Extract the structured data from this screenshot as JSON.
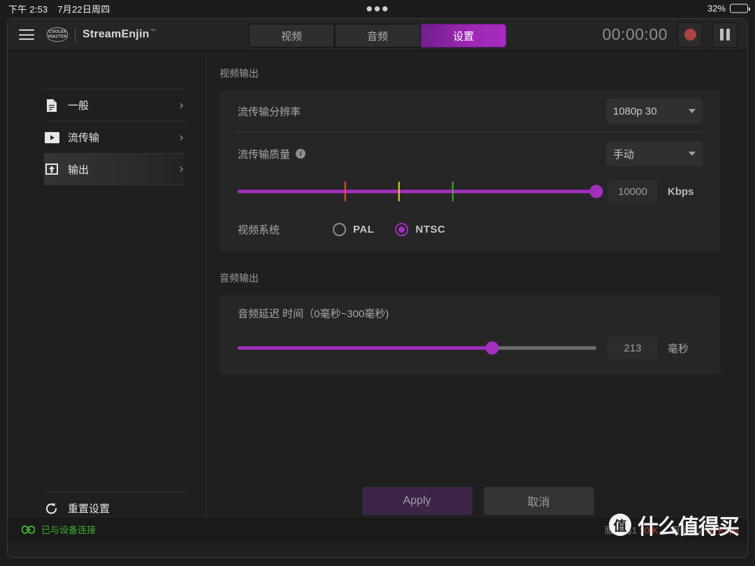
{
  "os_bar": {
    "time": "下午 2:53",
    "date": "7月22日周四",
    "menu_dots": "●●●",
    "battery_percent": "32%",
    "battery_level": 32
  },
  "header": {
    "menu_icon": "hamburger-icon",
    "logo_line1": "COOLER",
    "logo_line2": "MASTER",
    "app_name": "StreamEnjin",
    "trademark": "™",
    "tabs": [
      {
        "label": "视频",
        "active": false
      },
      {
        "label": "音频",
        "active": false
      },
      {
        "label": "设置",
        "active": true
      }
    ],
    "timer": "00:00:00",
    "record_icon": "record-icon",
    "pause_icon": "pause-icon"
  },
  "sidebar": {
    "items": [
      {
        "label": "一般",
        "icon": "document-icon",
        "active": false
      },
      {
        "label": "流传输",
        "icon": "play-video-icon",
        "active": false
      },
      {
        "label": "输出",
        "icon": "upload-icon",
        "active": true
      }
    ],
    "chevron": "›",
    "reset": {
      "label": "重置设置",
      "icon": "reset-arrow-icon"
    }
  },
  "video_section": {
    "title": "视频输出",
    "resolution": {
      "label": "流传输分辨率",
      "value": "1080p 30"
    },
    "quality": {
      "label": "流传输质量",
      "info_icon": "info-icon",
      "mode_value": "手动",
      "bitrate_value": "10000",
      "unit": "Kbps",
      "slider_percent": 100,
      "ticks": [
        {
          "percent": 30,
          "color": "#e8522f"
        },
        {
          "percent": 45,
          "color": "#e8d02f"
        },
        {
          "percent": 60,
          "color": "#3fae2f"
        }
      ]
    },
    "video_system": {
      "label": "视频系统",
      "options": [
        {
          "label": "PAL",
          "selected": false
        },
        {
          "label": "NTSC",
          "selected": true
        }
      ]
    }
  },
  "audio_section": {
    "title": "音频输出",
    "delay": {
      "label": "音频延迟 时间（0毫秒~300毫秒)",
      "value": "213",
      "unit": "毫秒",
      "slider_percent": 71
    }
  },
  "footer": {
    "apply_label": "Apply",
    "cancel_label": "取消"
  },
  "status_bar": {
    "connection_icon": "link-icon",
    "connection_text": "已与设备连接",
    "server1": "服务器1 :",
    "server1_value": "0 K",
    "server2": "服务器2 :",
    "server2_value": "0 Kbps"
  },
  "watermark": {
    "badge": "值",
    "text": "什么值得买"
  },
  "colors": {
    "accent": "#a32fbd",
    "tab_active": "#9d27b4",
    "connected": "#3fae2f",
    "error": "#c63b2e",
    "record": "#a94442"
  }
}
